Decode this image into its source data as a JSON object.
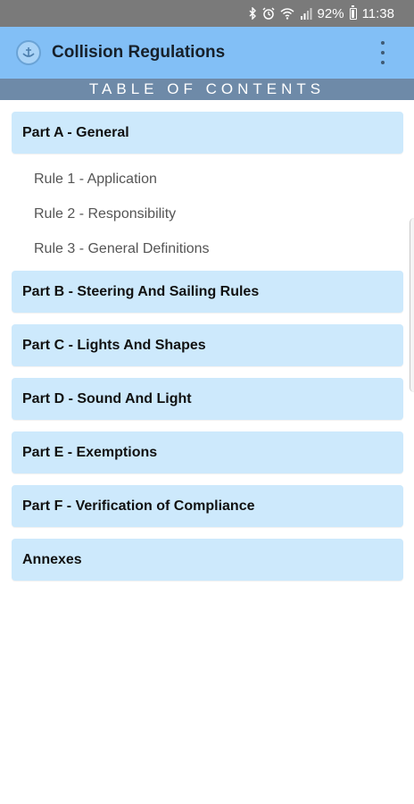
{
  "status_bar": {
    "icons": [
      "bluetooth-icon",
      "alarm-icon",
      "wifi-icon",
      "signal-icon",
      "battery-icon"
    ],
    "battery": "92%",
    "time": "11:38"
  },
  "app_bar": {
    "title": "Collision Regulations",
    "logo": "app-logo-icon",
    "menu_icon": "more-vert-icon",
    "color": "#82bff6"
  },
  "banner": {
    "title": "TABLE OF CONTENTS",
    "color": "#6e8aa8"
  },
  "toc": {
    "part_a": {
      "label": "Part A - General",
      "rules": [
        {
          "label": "Rule 1 - Application"
        },
        {
          "label": "Rule 2 - Responsibility"
        },
        {
          "label": "Rule 3 - General Definitions"
        }
      ]
    },
    "part_b": {
      "label": "Part B - Steering And Sailing Rules"
    },
    "part_c": {
      "label": "Part C - Lights And Shapes"
    },
    "part_d": {
      "label": "Part D - Sound And Light"
    },
    "part_e": {
      "label": "Part E - Exemptions"
    },
    "part_f": {
      "label": "Part F - Verification of Compliance"
    },
    "annexes": {
      "label": "Annexes"
    },
    "item_color": "#cde9fc"
  }
}
